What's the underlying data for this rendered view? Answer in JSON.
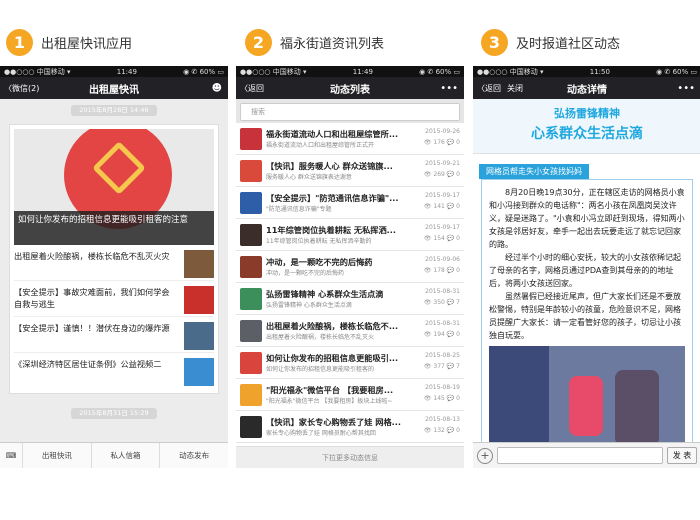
{
  "steps": [
    {
      "num": "1",
      "title": "出租屋快讯应用"
    },
    {
      "num": "2",
      "title": "福永街道资讯列表"
    },
    {
      "num": "3",
      "title": "及时报道社区动态"
    }
  ],
  "phone1": {
    "status": {
      "carrier": "●●○○○ 中国移动 ▾",
      "time": "11:49",
      "battery": "◉ ✆ 60% ▭"
    },
    "back": "〈微信(2)",
    "title": "出租屋快讯",
    "profile_icon": "person-icon",
    "timestamp_top": "2015年8月28日 14:46",
    "hero_caption": "如何让你发布的招租信息更能吸引租客的注意",
    "items": [
      "出租屋着火险酿祸，楼栋长临危不乱灭火灾",
      "【安全提示】事故灾难面前，我们如何学会自救与逃生",
      "【安全提示】谨慎！！潜伏在身边的爆炸源",
      "《深圳经济特区居住证条例》公益视频二"
    ],
    "timestamp_bottom": "2015年8月31日 15:29",
    "tabs": [
      "出租快讯",
      "私人信箱",
      "动态发布"
    ]
  },
  "phone2": {
    "status": {
      "carrier": "●●○○○ 中国移动 ▾",
      "time": "11:49",
      "battery": "◉ ✆ 60% ▭"
    },
    "back": "〈返回",
    "title": "动态列表",
    "more": "•••",
    "search_placeholder": "搜索",
    "items": [
      {
        "title": "福永街道流动人口和出租屋综管所...",
        "sub": "福永街道流动人口和出租屋综管所正式开",
        "date": "2015-09-26",
        "views": "176",
        "comments": "0",
        "color": "#c8323a"
      },
      {
        "title": "【快讯】服务暖人心 群众送锦旗...",
        "sub": "服务暖人心 群众送锦旗表达谢意",
        "date": "2015-09-21",
        "views": "269",
        "comments": "0",
        "color": "#d94a3a"
      },
      {
        "title": "【安全提示】\"防范通讯信息诈骗\"...",
        "sub": "\"防范通讯信息诈骗\"专题",
        "date": "2015-09-17",
        "views": "141",
        "comments": "0",
        "color": "#2f5ea8"
      },
      {
        "title": "11年综管岗位执着耕耘 无私挥洒...",
        "sub": "11年综管岗位执着耕耘 无私挥洒辛勤的",
        "date": "2015-09-17",
        "views": "154",
        "comments": "0",
        "color": "#3a2d2a"
      },
      {
        "title": "冲动，是一颗吃不完的后悔药",
        "sub": "冲动，是一颗吃不完的后悔药",
        "date": "2015-09-06",
        "views": "178",
        "comments": "0",
        "color": "#8a3b2a"
      },
      {
        "title": "弘扬雷锋精神 心系群众生活点滴",
        "sub": "弘扬雷锋精神 心系群众生活点滴",
        "date": "2015-08-31",
        "views": "350",
        "comments": "7",
        "color": "#3c8f5a"
      },
      {
        "title": "出租屋着火险酿祸，楼栋长临危不...",
        "sub": "出租屋着火险酿祸，楼栋长临危不乱灭火",
        "date": "2015-08-31",
        "views": "194",
        "comments": "0",
        "color": "#5c5f66"
      },
      {
        "title": "如何让你发布的招租信息更能吸引...",
        "sub": "如何让你发布的招租信息更能吸引租客的",
        "date": "2015-08-25",
        "views": "377",
        "comments": "7",
        "color": "#d9453d"
      },
      {
        "title": "\"阳光福永\"微信平台 【我要租房...",
        "sub": "\"阳光福永\"微信平台 【我要租房】板块上线啦~",
        "date": "2015-08-19",
        "views": "145",
        "comments": "0",
        "color": "#f0a32c"
      },
      {
        "title": "【快讯】家长专心购物丢了娃 网格...",
        "sub": "家长专心购物丢了娃 网格员耐心帮其找回",
        "date": "2015-08-13",
        "views": "132",
        "comments": "0",
        "color": "#2a2a2a"
      }
    ],
    "load_more": "下拉更多动态信息"
  },
  "phone3": {
    "status": {
      "carrier": "●●○○○ 中国移动 ▾",
      "time": "11:50",
      "battery": "◉ ✆ 60% ▭"
    },
    "back": "〈返回",
    "close": "关闭",
    "title": "动态详情",
    "more": "•••",
    "banner_line1": "弘扬雷锋精神",
    "banner_line2": "心系群众生活点滴",
    "tag": "网格员帮走失小女孩找妈妈",
    "p1": "8月20日晚19点30分，正在辖区走访的网格员小袁和小冯接到群众的电话称\"：两名小孩在凤凰岗吴汶许义，疑是迷路了。\"小袁和小冯立即赶到现场，得知两小女孩是邻居好友，牵手一起出去玩要走远了就忘记回家的路。",
    "p2": "经过半个小时的细心安抚，较大的小女孩依稀记起了母亲的名字，网格员通过PDA查到其母亲的的地址后，将两小女孩送回家。",
    "p3": "虽然暑假已经接近尾声，但广大家长们还是不要放松警惕，特别是年龄较小的孩童，危险意识不足，网格员提醒广大家长：请一定看管好您的孩子，切忌让小孩独自玩耍。",
    "send": "发 表"
  }
}
